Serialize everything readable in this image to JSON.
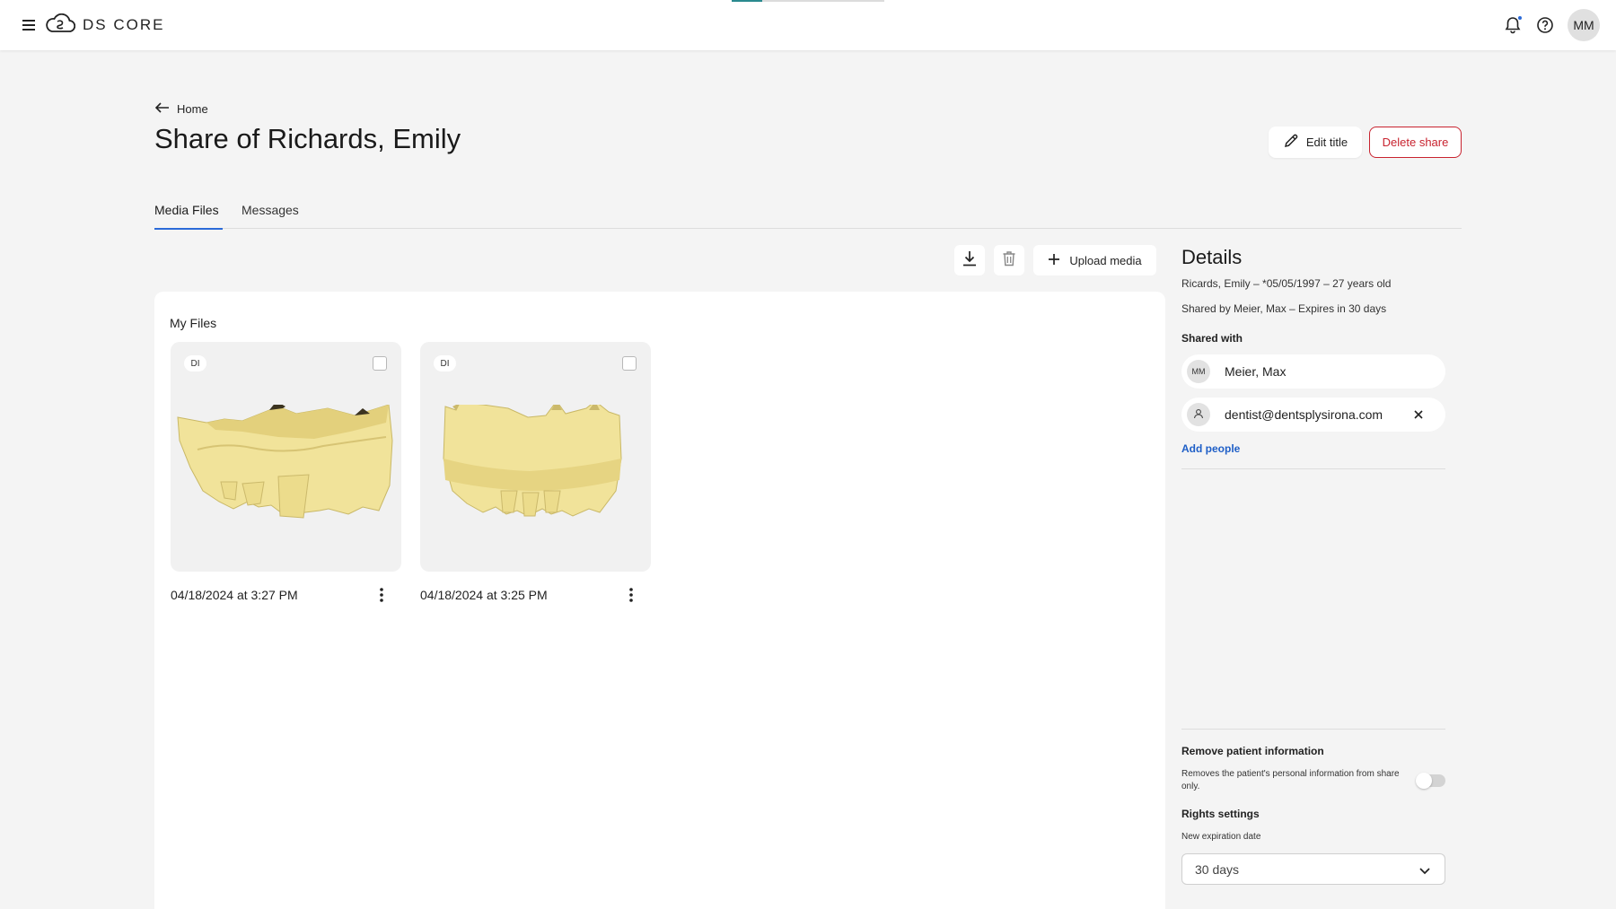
{
  "app": {
    "brand": "DS CORE",
    "user_initials": "MM",
    "loading_progress": 0.2
  },
  "nav": {
    "back_label": "Home"
  },
  "page": {
    "title": "Share of Richards, Emily",
    "edit_title_label": "Edit title",
    "delete_share_label": "Delete share"
  },
  "tabs": [
    {
      "label": "Media Files",
      "active": true
    },
    {
      "label": "Messages",
      "active": false
    }
  ],
  "toolbar": {
    "download_icon": "download-icon",
    "delete_icon": "trash-icon",
    "upload_label": "Upload media"
  },
  "files": {
    "heading": "My Files",
    "items": [
      {
        "badge": "DI",
        "date": "04/18/2024 at 3:27 PM",
        "selected": false
      },
      {
        "badge": "DI",
        "date": "04/18/2024 at 3:25 PM",
        "selected": false
      }
    ]
  },
  "details": {
    "title": "Details",
    "patient_line": "Ricards, Emily – *05/05/1997 – 27 years old",
    "shared_line": "Shared by Meier, Max – Expires in 30 days",
    "shared_with_label": "Shared with",
    "people": [
      {
        "initials": "MM",
        "name": "Meier, Max"
      },
      {
        "initials": "",
        "name": "dentist@dentsplysirona.com"
      }
    ],
    "add_people_label": "Add people",
    "remove_patient_info": {
      "title": "Remove patient information",
      "description": "Removes the patient's personal information from share only.",
      "enabled": false
    },
    "rights_settings": {
      "title": "Rights settings",
      "expiration_label": "New expiration date",
      "expiration_value": "30 days"
    }
  },
  "colors": {
    "accent": "#2b6ad8",
    "danger": "#c8232f",
    "link": "#1f5fc7",
    "model": "#f1e39a"
  }
}
